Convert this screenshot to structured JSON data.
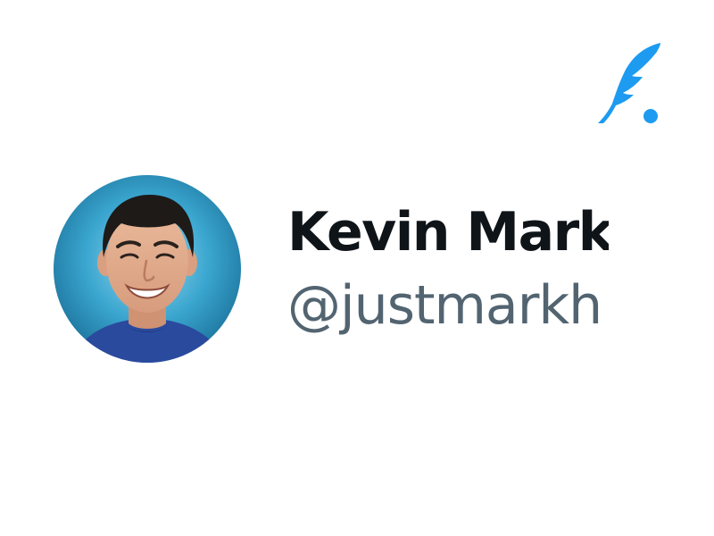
{
  "brand": {
    "logo_icon": "quill-icon",
    "accent_color": "#1d9bf0"
  },
  "profile": {
    "avatar_icon": "avatar",
    "display_name": "Kevin Mark",
    "handle": "@justmarkh"
  },
  "colors": {
    "name_text": "#0f1419",
    "handle_text": "#536471",
    "background": "#ffffff"
  }
}
